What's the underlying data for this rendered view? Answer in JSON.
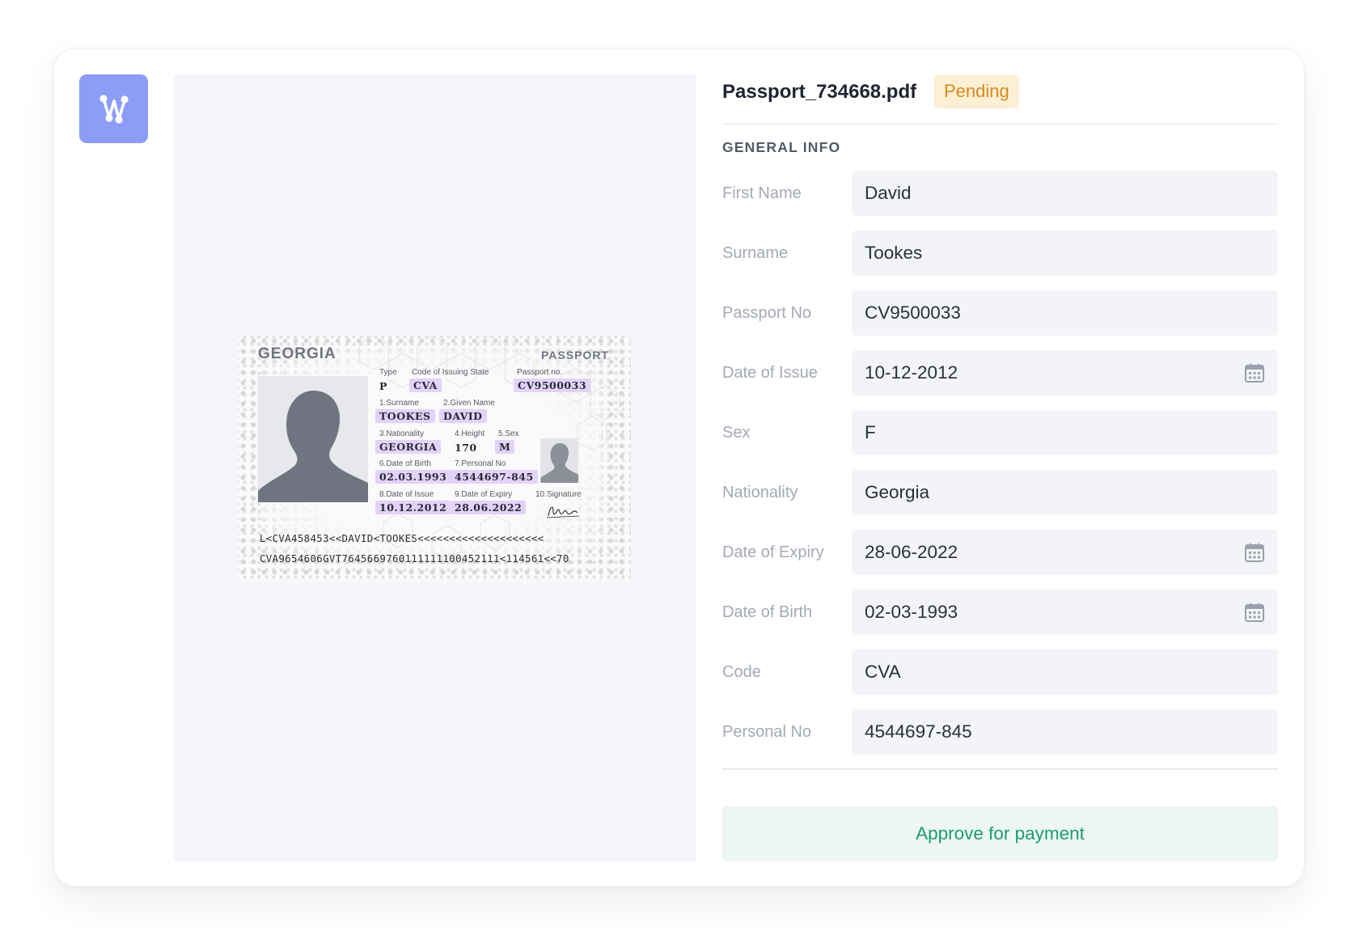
{
  "document": {
    "filename": "Passport_734668.pdf",
    "status": "Pending"
  },
  "section_title": "GENERAL INFO",
  "fields": [
    {
      "label": "First Name",
      "value": "David",
      "calendar": false
    },
    {
      "label": "Surname",
      "value": "Tookes",
      "calendar": false
    },
    {
      "label": "Passport No",
      "value": "CV9500033",
      "calendar": false
    },
    {
      "label": "Date of Issue",
      "value": "10-12-2012",
      "calendar": true
    },
    {
      "label": "Sex",
      "value": "F",
      "calendar": false
    },
    {
      "label": "Nationality",
      "value": "Georgia",
      "calendar": false
    },
    {
      "label": "Date of Expiry",
      "value": "28-06-2022",
      "calendar": true
    },
    {
      "label": "Date of Birth",
      "value": "02-03-1993",
      "calendar": true
    },
    {
      "label": "Code",
      "value": "CVA",
      "calendar": false
    },
    {
      "label": "Personal No",
      "value": "4544697-845",
      "calendar": false
    }
  ],
  "approve_label": "Approve for payment",
  "passport": {
    "country": "GEORGIA",
    "doc_type": "PASSPORT",
    "type_label": "Type",
    "type_value": "P",
    "code_label": "Code of Issuing State",
    "code_value": "CVA",
    "passport_no_label": "Passport no.",
    "passport_no_value": "CV9500033",
    "surname_label": "1.Surname",
    "surname_value": "TOOKES",
    "given_label": "2.Given Name",
    "given_value": "DAVID",
    "nationality_label": "3.Nationality",
    "nationality_value": "GEORGIA",
    "height_label": "4.Height",
    "height_value": "170",
    "sex_label": "5.Sex",
    "sex_value": "M",
    "dob_label": "6.Date of Birth",
    "dob_value": "02.03.1993",
    "personal_label": "7.Personal No",
    "personal_value": "4544697-845",
    "issue_label": "8.Date of Issue",
    "issue_value": "10.12.2012",
    "expiry_label": "9.Date of Expiry",
    "expiry_value": "28.06.2022",
    "signature_label": "10.Signature",
    "mrz_line1": "L<CVA458453<<DAVID<TOOKES<<<<<<<<<<<<<<<<<<<<",
    "mrz_line2": "CVA9654606GVT7645669760111111100452111<114561<<70"
  },
  "colors": {
    "accent_logo": "#8c9cf7",
    "badge_bg": "#fdefd4",
    "badge_text": "#d68a1c",
    "approve_bg": "#ecf6f3",
    "approve_text": "#1e9c6c",
    "highlight": "#e3d2f9"
  },
  "icons": {
    "logo": "graph-nodes-icon",
    "date_field": "calendar-icon"
  }
}
